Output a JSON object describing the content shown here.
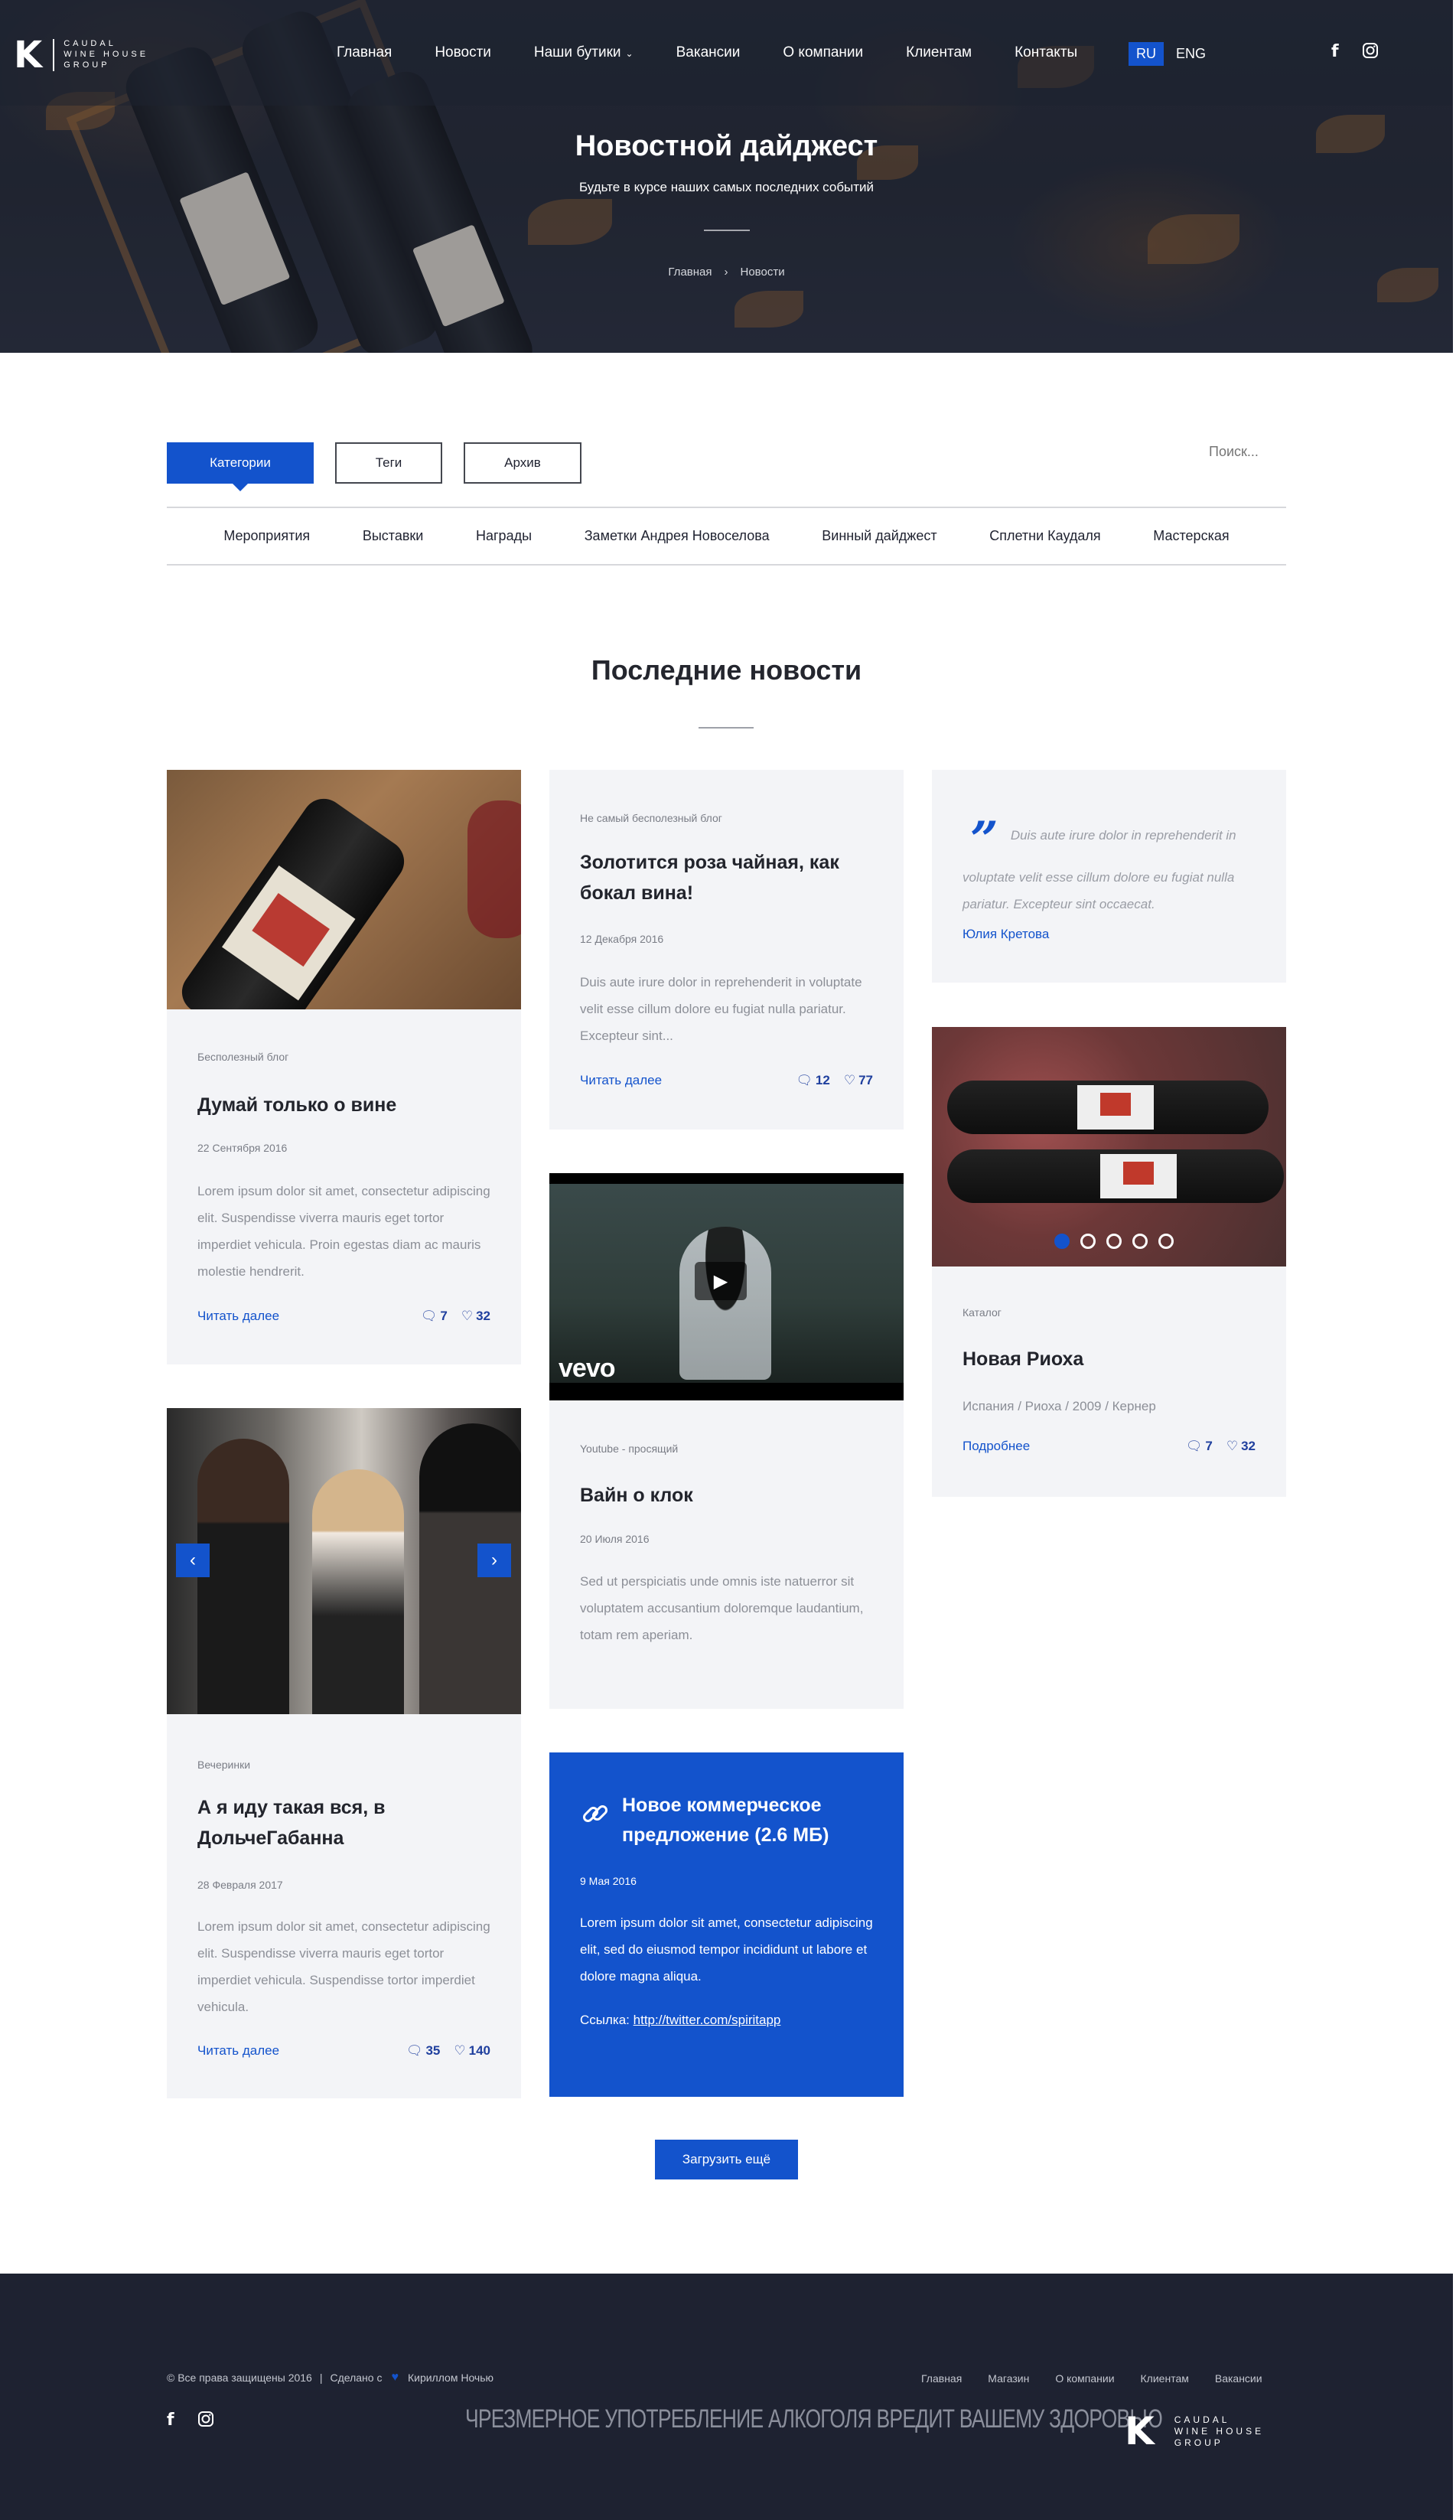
{
  "header": {
    "logo_letter": "K",
    "logo_lines": [
      "CAUDAL",
      "WINE HOUSE",
      "GROUP"
    ],
    "nav": [
      "Главная",
      "Новости",
      "Наши бутики",
      "Вакансии",
      "О компании",
      "Клиентам",
      "Контакты"
    ],
    "lang_active": "RU",
    "lang_other": "ENG"
  },
  "hero": {
    "title": "Новостной дайджест",
    "subtitle": "Будьте в курсе наших самых последних событий",
    "crumb_home": "Главная",
    "crumb_sep": "›",
    "crumb_current": "Новости"
  },
  "filters": {
    "tabs": [
      "Категории",
      "Теги",
      "Архив"
    ],
    "search_placeholder": "Поиск...",
    "categories": [
      "Мероприятия",
      "Выставки",
      "Награды",
      "Заметки Андрея Новоселова",
      "Винный дайджест",
      "Сплетни Каудаля",
      "Мастерская"
    ]
  },
  "section_title": "Последние новости",
  "cards": {
    "c1": {
      "meta": "Бесполезный блог",
      "title": "Думай только о вине",
      "date": "22 Сентября 2016",
      "text": "Lorem ipsum dolor sit amet, consectetur adipiscing elit. Suspendisse viverra mauris eget tortor imperdiet vehicula. Proin egestas diam ac mauris molestie hendrerit.",
      "read": "Читать далее",
      "comments": "7",
      "likes": "32"
    },
    "c2": {
      "meta": "Не самый бесполезный блог",
      "title": "Золотится роза чайная, как бокал вина!",
      "date": "12 Декабря 2016",
      "text": "Duis aute irure dolor in reprehenderit in voluptate velit esse cillum dolore eu fugiat nulla pariatur. Excepteur sint...",
      "read": "Читать далее",
      "comments": "12",
      "likes": "77"
    },
    "c3": {
      "quote": "Duis aute irure dolor in reprehenderit in voluptate velit esse cillum dolore eu fugiat nulla pariatur. Excepteur sint occaecat.",
      "author": "Юлия Кретова"
    },
    "c4": {
      "meta": "Youtube - просящий",
      "title": "Вайн о клок",
      "date": "20 Июля 2016",
      "text": "Sed ut perspiciatis unde omnis iste natuerror sit voluptatem accusantium doloremque laudantium, totam rem aperiam.",
      "vevo": "vevo"
    },
    "c5": {
      "meta": "Каталог",
      "title": "Новая Риоха",
      "details": "Испания / Риоха / 2009 / Кернер",
      "read": "Подробнее",
      "comments": "7",
      "likes": "32"
    },
    "c6": {
      "meta": "Вечеринки",
      "title": "А я иду такая вся, в ДольчеГабанна",
      "date": "28 Февраля 2017",
      "text": "Lorem ipsum dolor sit amet, consectetur adipiscing elit. Suspendisse viverra mauris eget tortor imperdiet vehicula. Suspendisse tortor imperdiet vehicula.",
      "read": "Читать далее",
      "comments": "35",
      "likes": "140"
    },
    "c7": {
      "title": "Новое коммерческое предложение (2.6 МБ)",
      "date": "9 Мая 2016",
      "text": "Lorem ipsum dolor sit amet, consectetur adipiscing elit, sed do eiusmod tempor incididunt ut labore et dolore magna aliqua.",
      "link_label": "Ссылка:",
      "link_url": "http://twitter.com/spiritapp"
    }
  },
  "load_more": "Загрузить ещё",
  "footer": {
    "copyright": "© Все права защищены 2016",
    "made_with": "Сделано с",
    "made_by": "Кириллом Ночью",
    "nav": [
      "Главная",
      "Магазин",
      "О компании",
      "Клиентам",
      "Вакансии"
    ],
    "warning": "ЧРЕЗМЕРНОЕ УПОТРЕБЛЕНИЕ АЛКОГОЛЯ ВРЕДИТ ВАШЕМУ ЗДОРОВЬЮ",
    "logo_letter": "K",
    "logo_lines": [
      "CAUDAL",
      "WINE HOUSE",
      "GROUP"
    ]
  },
  "colors": {
    "accent": "#1353cc",
    "dark": "#1e2231",
    "card_bg": "#f3f4f7"
  },
  "icons": [
    "facebook-icon",
    "instagram-icon",
    "chevron-down-icon",
    "comment-icon",
    "heart-icon",
    "quote-icon",
    "link-icon",
    "play-icon",
    "arrow-left-icon",
    "arrow-right-icon"
  ]
}
